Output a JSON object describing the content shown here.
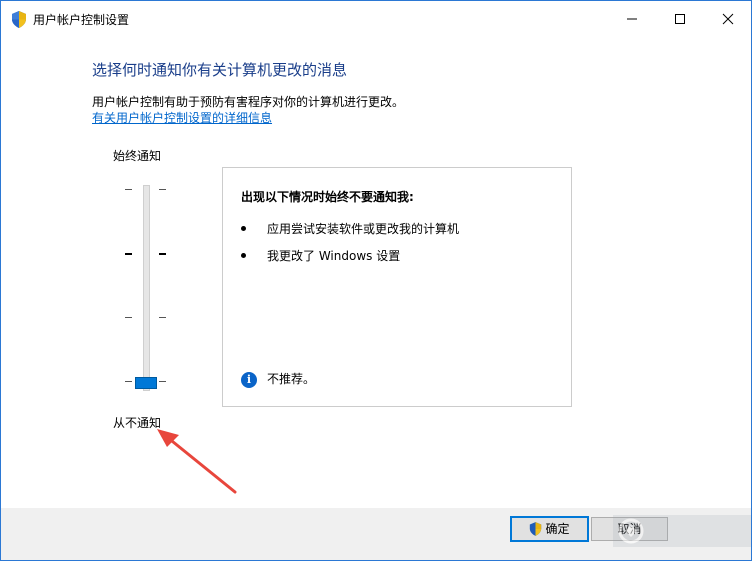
{
  "window": {
    "title": "用户帐户控制设置"
  },
  "content": {
    "heading": "选择何时通知你有关计算机更改的消息",
    "description": "用户帐户控制有助于预防有害程序对你的计算机进行更改。",
    "link_text": "有关用户帐户控制设置的详细信息"
  },
  "slider": {
    "top_label": "始终通知",
    "bottom_label": "从不通知",
    "levels": 4,
    "selected_level": 1
  },
  "info_panel": {
    "title": "出现以下情况时始终不要通知我:",
    "bullets": [
      "应用尝试安装软件或更改我的计算机",
      "我更改了 Windows 设置"
    ],
    "note": "不推荐。"
  },
  "footer": {
    "ok_label": "确定",
    "cancel_label": "取消"
  },
  "colors": {
    "accent": "#0078d7",
    "heading": "#1a3e8a",
    "link": "#0066cc",
    "annotation_arrow": "#e8463c"
  }
}
